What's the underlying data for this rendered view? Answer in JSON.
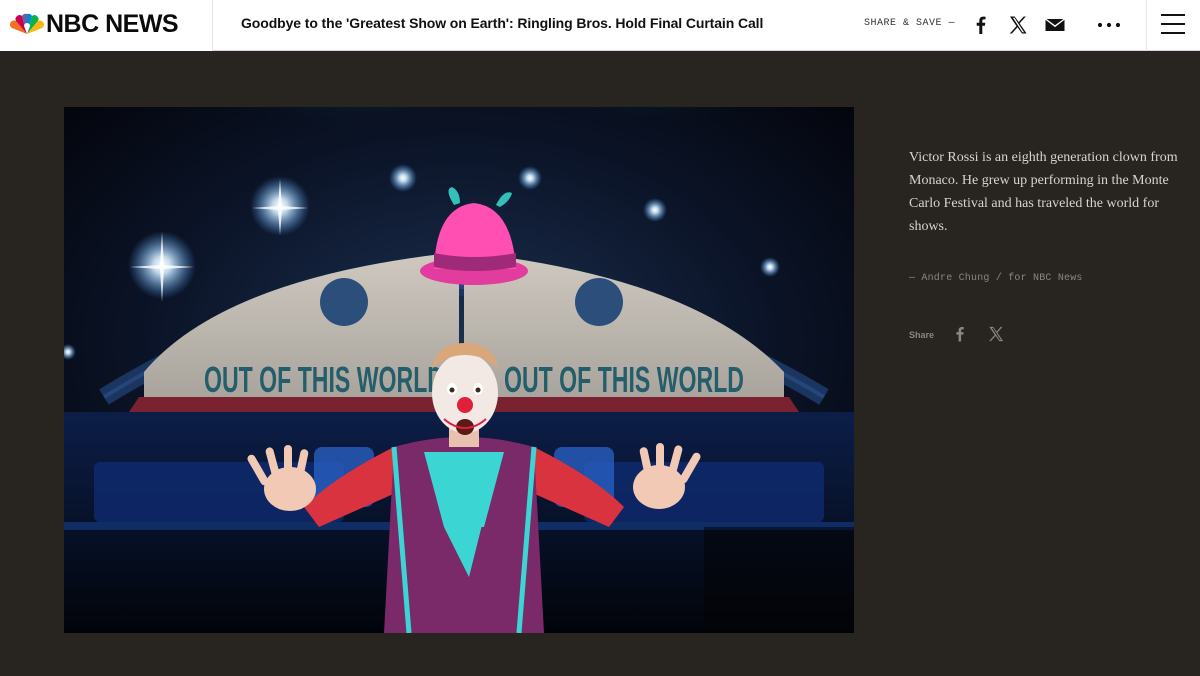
{
  "header": {
    "brand": "NBC NEWS",
    "headline": "Goodbye to the 'Greatest Show on Earth': Ringling Bros. Hold Final Curtain Call",
    "share_save_label": "SHARE & SAVE —",
    "icons": [
      "facebook-icon",
      "x-icon",
      "email-icon",
      "more-icon",
      "menu-icon"
    ]
  },
  "photo": {
    "banner_text_left": "OUT OF THIS WORLD",
    "banner_text_right": "OUT OF THIS WORLD"
  },
  "caption": {
    "text": "Victor Rossi is an eighth generation clown from Monaco. He grew up performing in the Monte Carlo Festival and has traveled the world for shows.",
    "credit": "— Andre Chung / for NBC News"
  },
  "share": {
    "label": "Share",
    "icons": [
      "facebook-icon",
      "x-icon"
    ]
  },
  "colors": {
    "background": "#282520",
    "header": "#ffffff",
    "caption_text": "#d9d5cc",
    "muted": "#8a867c"
  }
}
